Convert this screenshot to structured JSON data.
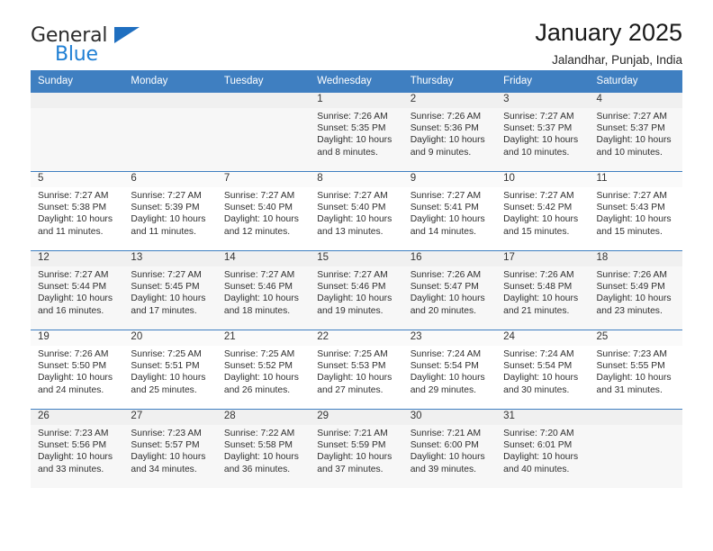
{
  "brand": {
    "name_part1": "General",
    "name_part2": "Blue",
    "triangle_color": "#1f6fc0",
    "blue_color": "#1f7fd4"
  },
  "header": {
    "title": "January 2025",
    "subtitle": "Jalandhar, Punjab, India"
  },
  "theme": {
    "header_bg": "#3f7fc1",
    "header_text": "#ffffff",
    "shaded_cell_bg": "#f7f7f7",
    "daynum_bg": "#f0f0f0"
  },
  "weekdays": [
    "Sunday",
    "Monday",
    "Tuesday",
    "Wednesday",
    "Thursday",
    "Friday",
    "Saturday"
  ],
  "weeks": [
    [
      {
        "day": "",
        "sunrise": "",
        "sunset": "",
        "daylight_line1": "",
        "daylight_line2": "",
        "empty": true
      },
      {
        "day": "",
        "sunrise": "",
        "sunset": "",
        "daylight_line1": "",
        "daylight_line2": "",
        "empty": true
      },
      {
        "day": "",
        "sunrise": "",
        "sunset": "",
        "daylight_line1": "",
        "daylight_line2": "",
        "empty": true
      },
      {
        "day": "1",
        "sunrise": "Sunrise: 7:26 AM",
        "sunset": "Sunset: 5:35 PM",
        "daylight_line1": "Daylight: 10 hours",
        "daylight_line2": "and 8 minutes."
      },
      {
        "day": "2",
        "sunrise": "Sunrise: 7:26 AM",
        "sunset": "Sunset: 5:36 PM",
        "daylight_line1": "Daylight: 10 hours",
        "daylight_line2": "and 9 minutes."
      },
      {
        "day": "3",
        "sunrise": "Sunrise: 7:27 AM",
        "sunset": "Sunset: 5:37 PM",
        "daylight_line1": "Daylight: 10 hours",
        "daylight_line2": "and 10 minutes."
      },
      {
        "day": "4",
        "sunrise": "Sunrise: 7:27 AM",
        "sunset": "Sunset: 5:37 PM",
        "daylight_line1": "Daylight: 10 hours",
        "daylight_line2": "and 10 minutes."
      }
    ],
    [
      {
        "day": "5",
        "sunrise": "Sunrise: 7:27 AM",
        "sunset": "Sunset: 5:38 PM",
        "daylight_line1": "Daylight: 10 hours",
        "daylight_line2": "and 11 minutes."
      },
      {
        "day": "6",
        "sunrise": "Sunrise: 7:27 AM",
        "sunset": "Sunset: 5:39 PM",
        "daylight_line1": "Daylight: 10 hours",
        "daylight_line2": "and 11 minutes."
      },
      {
        "day": "7",
        "sunrise": "Sunrise: 7:27 AM",
        "sunset": "Sunset: 5:40 PM",
        "daylight_line1": "Daylight: 10 hours",
        "daylight_line2": "and 12 minutes."
      },
      {
        "day": "8",
        "sunrise": "Sunrise: 7:27 AM",
        "sunset": "Sunset: 5:40 PM",
        "daylight_line1": "Daylight: 10 hours",
        "daylight_line2": "and 13 minutes."
      },
      {
        "day": "9",
        "sunrise": "Sunrise: 7:27 AM",
        "sunset": "Sunset: 5:41 PM",
        "daylight_line1": "Daylight: 10 hours",
        "daylight_line2": "and 14 minutes."
      },
      {
        "day": "10",
        "sunrise": "Sunrise: 7:27 AM",
        "sunset": "Sunset: 5:42 PM",
        "daylight_line1": "Daylight: 10 hours",
        "daylight_line2": "and 15 minutes."
      },
      {
        "day": "11",
        "sunrise": "Sunrise: 7:27 AM",
        "sunset": "Sunset: 5:43 PM",
        "daylight_line1": "Daylight: 10 hours",
        "daylight_line2": "and 15 minutes."
      }
    ],
    [
      {
        "day": "12",
        "sunrise": "Sunrise: 7:27 AM",
        "sunset": "Sunset: 5:44 PM",
        "daylight_line1": "Daylight: 10 hours",
        "daylight_line2": "and 16 minutes."
      },
      {
        "day": "13",
        "sunrise": "Sunrise: 7:27 AM",
        "sunset": "Sunset: 5:45 PM",
        "daylight_line1": "Daylight: 10 hours",
        "daylight_line2": "and 17 minutes."
      },
      {
        "day": "14",
        "sunrise": "Sunrise: 7:27 AM",
        "sunset": "Sunset: 5:46 PM",
        "daylight_line1": "Daylight: 10 hours",
        "daylight_line2": "and 18 minutes."
      },
      {
        "day": "15",
        "sunrise": "Sunrise: 7:27 AM",
        "sunset": "Sunset: 5:46 PM",
        "daylight_line1": "Daylight: 10 hours",
        "daylight_line2": "and 19 minutes."
      },
      {
        "day": "16",
        "sunrise": "Sunrise: 7:26 AM",
        "sunset": "Sunset: 5:47 PM",
        "daylight_line1": "Daylight: 10 hours",
        "daylight_line2": "and 20 minutes."
      },
      {
        "day": "17",
        "sunrise": "Sunrise: 7:26 AM",
        "sunset": "Sunset: 5:48 PM",
        "daylight_line1": "Daylight: 10 hours",
        "daylight_line2": "and 21 minutes."
      },
      {
        "day": "18",
        "sunrise": "Sunrise: 7:26 AM",
        "sunset": "Sunset: 5:49 PM",
        "daylight_line1": "Daylight: 10 hours",
        "daylight_line2": "and 23 minutes."
      }
    ],
    [
      {
        "day": "19",
        "sunrise": "Sunrise: 7:26 AM",
        "sunset": "Sunset: 5:50 PM",
        "daylight_line1": "Daylight: 10 hours",
        "daylight_line2": "and 24 minutes."
      },
      {
        "day": "20",
        "sunrise": "Sunrise: 7:25 AM",
        "sunset": "Sunset: 5:51 PM",
        "daylight_line1": "Daylight: 10 hours",
        "daylight_line2": "and 25 minutes."
      },
      {
        "day": "21",
        "sunrise": "Sunrise: 7:25 AM",
        "sunset": "Sunset: 5:52 PM",
        "daylight_line1": "Daylight: 10 hours",
        "daylight_line2": "and 26 minutes."
      },
      {
        "day": "22",
        "sunrise": "Sunrise: 7:25 AM",
        "sunset": "Sunset: 5:53 PM",
        "daylight_line1": "Daylight: 10 hours",
        "daylight_line2": "and 27 minutes."
      },
      {
        "day": "23",
        "sunrise": "Sunrise: 7:24 AM",
        "sunset": "Sunset: 5:54 PM",
        "daylight_line1": "Daylight: 10 hours",
        "daylight_line2": "and 29 minutes."
      },
      {
        "day": "24",
        "sunrise": "Sunrise: 7:24 AM",
        "sunset": "Sunset: 5:54 PM",
        "daylight_line1": "Daylight: 10 hours",
        "daylight_line2": "and 30 minutes."
      },
      {
        "day": "25",
        "sunrise": "Sunrise: 7:23 AM",
        "sunset": "Sunset: 5:55 PM",
        "daylight_line1": "Daylight: 10 hours",
        "daylight_line2": "and 31 minutes."
      }
    ],
    [
      {
        "day": "26",
        "sunrise": "Sunrise: 7:23 AM",
        "sunset": "Sunset: 5:56 PM",
        "daylight_line1": "Daylight: 10 hours",
        "daylight_line2": "and 33 minutes."
      },
      {
        "day": "27",
        "sunrise": "Sunrise: 7:23 AM",
        "sunset": "Sunset: 5:57 PM",
        "daylight_line1": "Daylight: 10 hours",
        "daylight_line2": "and 34 minutes."
      },
      {
        "day": "28",
        "sunrise": "Sunrise: 7:22 AM",
        "sunset": "Sunset: 5:58 PM",
        "daylight_line1": "Daylight: 10 hours",
        "daylight_line2": "and 36 minutes."
      },
      {
        "day": "29",
        "sunrise": "Sunrise: 7:21 AM",
        "sunset": "Sunset: 5:59 PM",
        "daylight_line1": "Daylight: 10 hours",
        "daylight_line2": "and 37 minutes."
      },
      {
        "day": "30",
        "sunrise": "Sunrise: 7:21 AM",
        "sunset": "Sunset: 6:00 PM",
        "daylight_line1": "Daylight: 10 hours",
        "daylight_line2": "and 39 minutes."
      },
      {
        "day": "31",
        "sunrise": "Sunrise: 7:20 AM",
        "sunset": "Sunset: 6:01 PM",
        "daylight_line1": "Daylight: 10 hours",
        "daylight_line2": "and 40 minutes."
      },
      {
        "day": "",
        "sunrise": "",
        "sunset": "",
        "daylight_line1": "",
        "daylight_line2": "",
        "empty": true
      }
    ]
  ]
}
